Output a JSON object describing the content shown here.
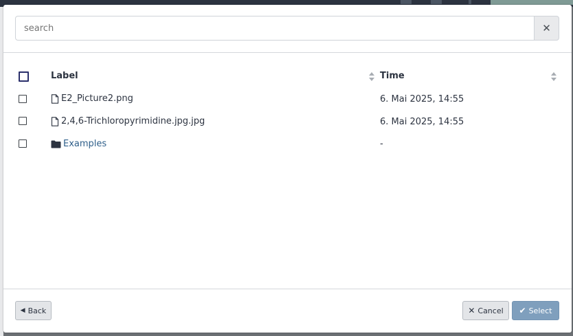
{
  "search": {
    "placeholder": "search",
    "clear_icon": "close-icon"
  },
  "table": {
    "columns": [
      {
        "label": "Label",
        "sortable": true
      },
      {
        "label": "Time",
        "sortable": true
      }
    ],
    "rows": [
      {
        "type": "file",
        "icon": "file-icon",
        "label": "E2_Picture2.png",
        "time": "6. Mai 2025, 14:55"
      },
      {
        "type": "file",
        "icon": "file-icon",
        "label": "2,4,6-Trichloropyrimidine.jpg.jpg",
        "time": "6. Mai 2025, 14:55"
      },
      {
        "type": "folder",
        "icon": "folder-icon",
        "label": "Examples",
        "time": "-"
      }
    ]
  },
  "footer": {
    "back_label": "Back",
    "cancel_label": "Cancel",
    "select_label": "Select"
  },
  "colors": {
    "primary_button": "#7f9fbd",
    "folder_link": "#2f5f8a",
    "text": "#2c3340"
  }
}
